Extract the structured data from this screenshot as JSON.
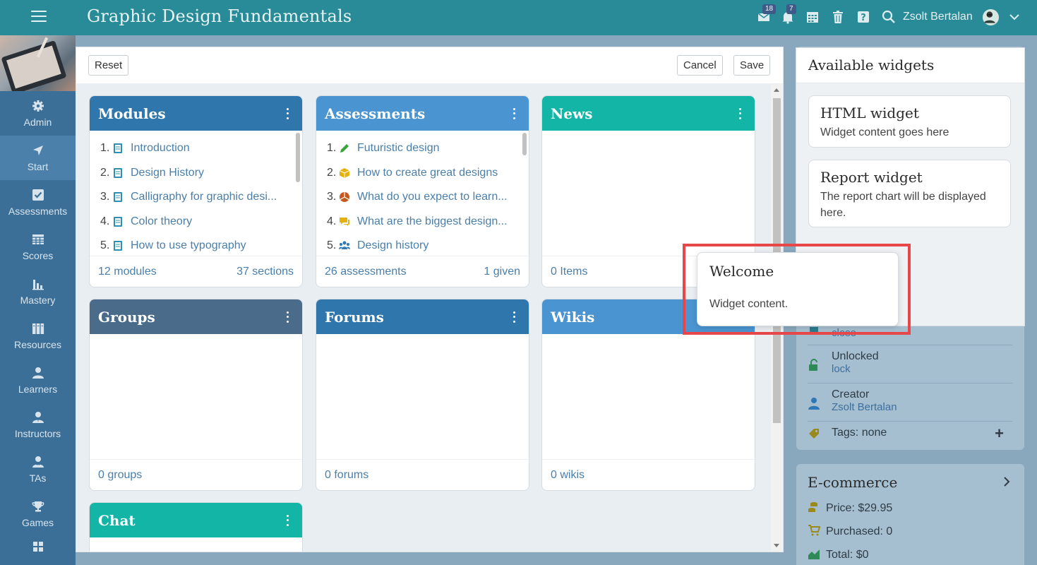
{
  "header": {
    "title": "Graphic Design Fundamentals",
    "messages_badge": "18",
    "notifications_badge": "7",
    "user_name": "Zsolt Bertalan",
    "bar_color": "#2a8b98"
  },
  "sidebar": {
    "items": [
      {
        "label": "Admin",
        "icon": "gear-icon"
      },
      {
        "label": "Start",
        "icon": "send-icon"
      },
      {
        "label": "Assessments",
        "icon": "checkbox-icon"
      },
      {
        "label": "Scores",
        "icon": "table-icon"
      },
      {
        "label": "Mastery",
        "icon": "bar-chart-icon"
      },
      {
        "label": "Resources",
        "icon": "books-icon"
      },
      {
        "label": "Learners",
        "icon": "person-icon"
      },
      {
        "label": "Instructors",
        "icon": "instructor-icon"
      },
      {
        "label": "TAs",
        "icon": "ta-icon"
      },
      {
        "label": "Games",
        "icon": "trophy-icon"
      }
    ],
    "active": "Start"
  },
  "toolbar": {
    "reset_label": "Reset",
    "cancel_label": "Cancel",
    "save_label": "Save"
  },
  "widgets": {
    "modules": {
      "title": "Modules",
      "color": "#2f76ad",
      "items": [
        {
          "num": "1.",
          "text": "Introduction"
        },
        {
          "num": "2.",
          "text": "Design History"
        },
        {
          "num": "3.",
          "text": "Calligraphy for graphic desi..."
        },
        {
          "num": "4.",
          "text": "Color theory"
        },
        {
          "num": "5.",
          "text": "How to use typography"
        }
      ],
      "footer_left": "12 modules",
      "footer_right": "37 sections"
    },
    "assessments": {
      "title": "Assessments",
      "color": "#4a95d1",
      "items": [
        {
          "num": "1.",
          "text": "Futuristic design",
          "icon": "pencil-icon"
        },
        {
          "num": "2.",
          "text": "How to create great designs",
          "icon": "cube-icon"
        },
        {
          "num": "3.",
          "text": "What do you expect to learn...",
          "icon": "pie-icon"
        },
        {
          "num": "4.",
          "text": "What are the biggest design...",
          "icon": "chat-icon"
        },
        {
          "num": "5.",
          "text": "Design history",
          "icon": "group-icon"
        }
      ],
      "footer_left": "26 assessments",
      "footer_right": "1 given"
    },
    "news": {
      "title": "News",
      "color": "#12b5a6",
      "footer_left": "0 Items"
    },
    "groups": {
      "title": "Groups",
      "color": "#4a6b8a",
      "footer_left": "0 groups"
    },
    "forums": {
      "title": "Forums",
      "color": "#2f76ad",
      "footer_left": "0 forums"
    },
    "wikis": {
      "title": "Wikis",
      "color": "#4a95d1",
      "footer_left": "0 wikis"
    },
    "chat": {
      "title": "Chat",
      "color": "#12b5a6"
    }
  },
  "available": {
    "heading": "Available widgets",
    "html_widget": {
      "title": "HTML widget",
      "desc": "Widget content goes here"
    },
    "report_widget": {
      "title": "Report widget",
      "desc": "The report chart will be displayed here."
    }
  },
  "dragging": {
    "title": "Welcome",
    "content": "Widget content."
  },
  "course_info": {
    "close_label": "close",
    "unlocked_label": "Unlocked",
    "lock_label": "lock",
    "creator_label": "Creator",
    "creator_name": "Zsolt Bertalan",
    "tags": "Tags: none"
  },
  "ecommerce": {
    "title": "E-commerce",
    "price": "Price: $29.95",
    "purchased": "Purchased: 0",
    "total": "Total: $0"
  }
}
